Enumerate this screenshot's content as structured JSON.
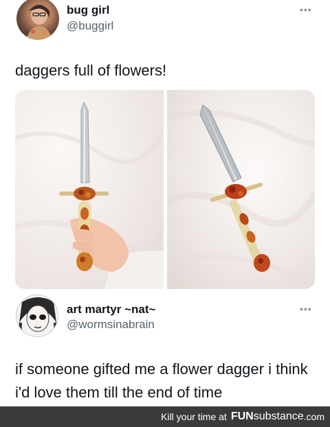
{
  "tweet1": {
    "display_name": "bug girl",
    "handle": "@buggirl",
    "more": "•••",
    "text": "daggers full of flowers!",
    "media": [
      {
        "label": "dagger with flower resin handle held in hand"
      },
      {
        "label": "dagger with flower resin handle on white fabric"
      }
    ]
  },
  "tweet2": {
    "display_name": "art martyr ~nat~",
    "handle": "@wormsinabrain",
    "more": "•••",
    "text": "if someone gifted me a flower dagger i think i'd love them till the end of time"
  },
  "footer": {
    "tagline": "Kill your time at",
    "brand_bold": "FUN",
    "brand_thin": "substance",
    "domain": ".com"
  },
  "colors": {
    "handle": "#536471",
    "text": "#0f1419",
    "footer_bg": "#3a3a3a"
  }
}
